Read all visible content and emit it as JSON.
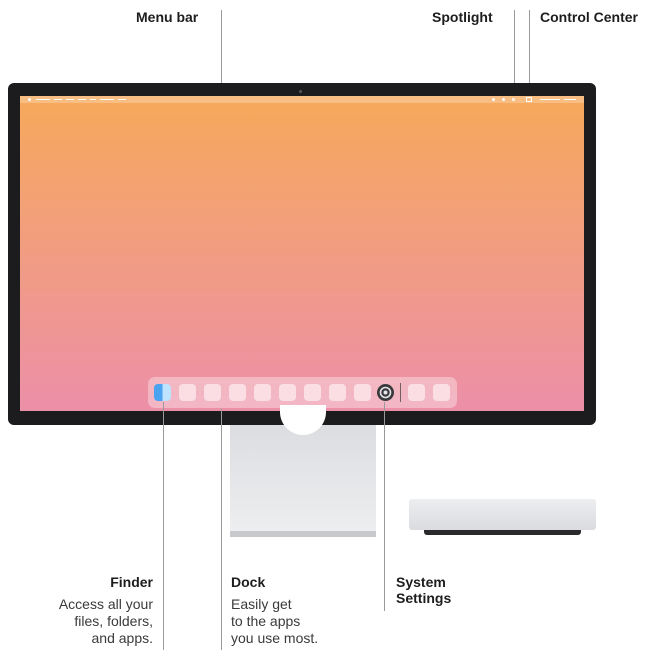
{
  "callouts": {
    "menu_bar": {
      "label": "Menu bar"
    },
    "spotlight": {
      "label": "Spotlight"
    },
    "control_center": {
      "label": "Control Center"
    },
    "finder": {
      "label": "Finder",
      "description": [
        "Access all your",
        "files, folders,",
        "and apps."
      ]
    },
    "dock": {
      "label": "Dock",
      "description": [
        "Easily get",
        "to the apps",
        "you use most."
      ]
    },
    "system_settings": {
      "label": [
        "System",
        "Settings"
      ]
    }
  },
  "icons": {
    "finder": "finder-icon",
    "system_settings": "gear-icon",
    "spotlight": "search-icon",
    "control_center": "control-center-icon"
  },
  "colors": {
    "wallpaper_top": "#f6a95a",
    "wallpaper_bottom": "#ec8fa8",
    "bezel": "#1c1c1e"
  }
}
